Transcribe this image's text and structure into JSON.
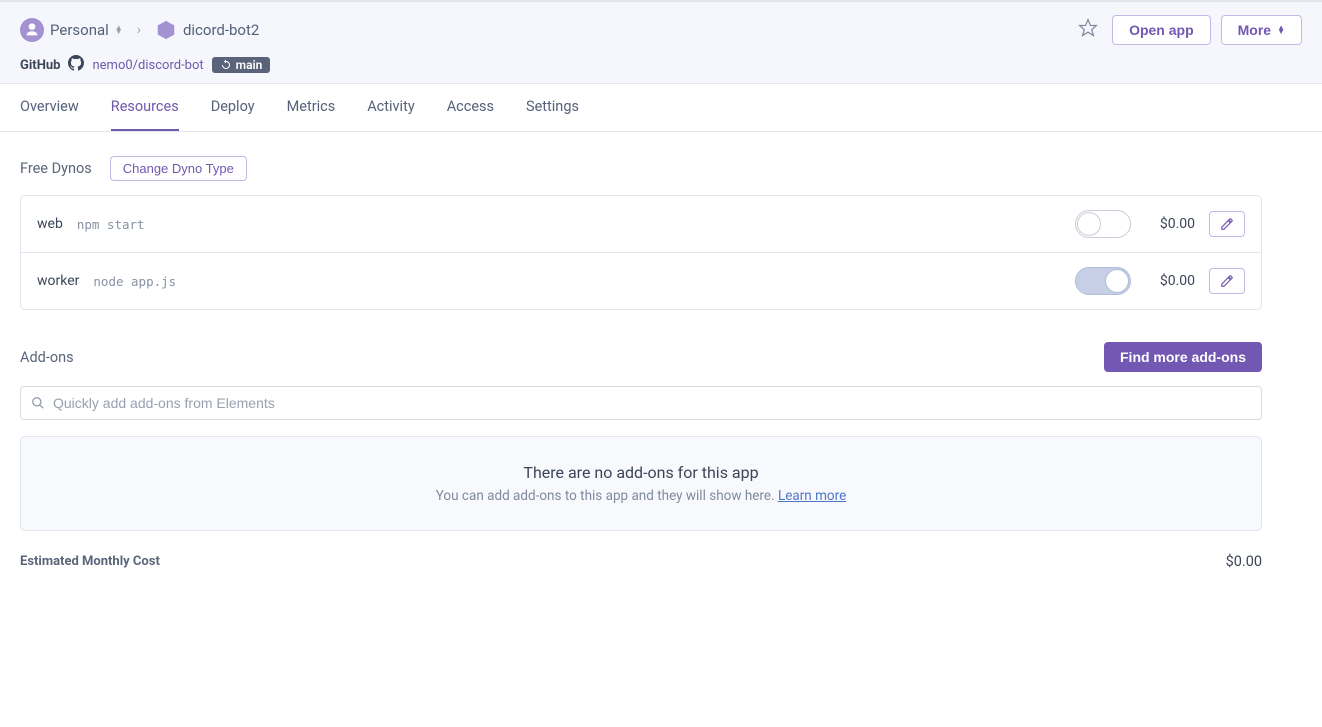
{
  "header": {
    "account_label": "Personal",
    "app_name": "dicord-bot2",
    "open_app_label": "Open app",
    "more_label": "More",
    "github_label": "GitHub",
    "github_repo": "nemo0/discord-bot",
    "branch_name": "main"
  },
  "tabs": [
    {
      "id": "overview",
      "label": "Overview",
      "active": false
    },
    {
      "id": "resources",
      "label": "Resources",
      "active": true
    },
    {
      "id": "deploy",
      "label": "Deploy",
      "active": false
    },
    {
      "id": "metrics",
      "label": "Metrics",
      "active": false
    },
    {
      "id": "activity",
      "label": "Activity",
      "active": false
    },
    {
      "id": "access",
      "label": "Access",
      "active": false
    },
    {
      "id": "settings",
      "label": "Settings",
      "active": false
    }
  ],
  "dynos": {
    "section_title": "Free Dynos",
    "change_type_label": "Change Dyno Type",
    "rows": [
      {
        "type": "web",
        "cmd": "npm start",
        "enabled": false,
        "cost": "$0.00"
      },
      {
        "type": "worker",
        "cmd": "node app.js",
        "enabled": true,
        "cost": "$0.00"
      }
    ]
  },
  "addons": {
    "section_title": "Add-ons",
    "find_more_label": "Find more add-ons",
    "search_placeholder": "Quickly add add-ons from Elements",
    "empty_title": "There are no add-ons for this app",
    "empty_sub_prefix": "You can add add-ons to this app and they will show here. ",
    "learn_more": "Learn more"
  },
  "estimate": {
    "label": "Estimated Monthly Cost",
    "value": "$0.00"
  }
}
